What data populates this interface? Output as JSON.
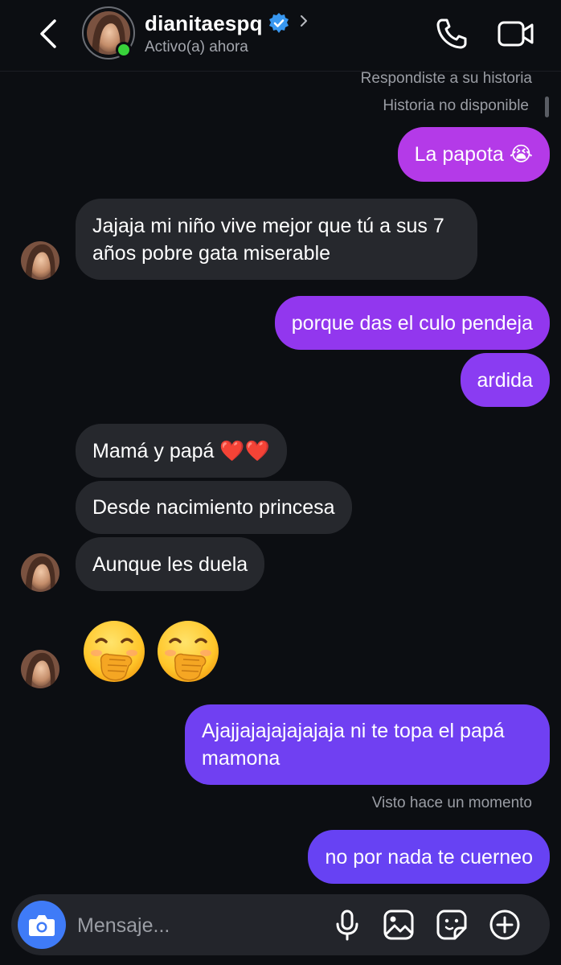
{
  "header": {
    "username": "dianitaespq",
    "status": "Activo(a) ahora",
    "verified": true
  },
  "meta": {
    "replied_story": "Respondiste a su historia",
    "story_unavailable": "Historia no disponible",
    "seen": "Visto hace un momento"
  },
  "messages": [
    {
      "from": "me",
      "text": "La papota 😭"
    },
    {
      "from": "them",
      "text": "Jajaja mi niño vive mejor que tú a sus 7 años pobre gata miserable"
    },
    {
      "from": "me",
      "text": "porque das el culo pendeja"
    },
    {
      "from": "me",
      "text": "ardida"
    },
    {
      "from": "them",
      "text": "Mamá y papá ❤️❤️"
    },
    {
      "from": "them",
      "text": "Desde nacimiento princesa"
    },
    {
      "from": "them",
      "text": "Aunque les duela"
    },
    {
      "from": "them",
      "emoji": "hand-over-mouth x2"
    },
    {
      "from": "me",
      "text": "Ajajjajajajajajaja ni te topa el papá mamona"
    },
    {
      "from": "me",
      "text": "no por nada te cuerneo"
    }
  ],
  "composer": {
    "placeholder": "Mensaje..."
  },
  "colors": {
    "background": "#0c0e12",
    "incoming_bubble": "#26282d",
    "outgoing_pink": "#b43ae8",
    "outgoing_purple": "#8a3cf2",
    "outgoing_blue": "#6c42f2",
    "camera_button": "#3f7bf7",
    "verified_badge": "#3897f0",
    "online": "#38d23a"
  }
}
